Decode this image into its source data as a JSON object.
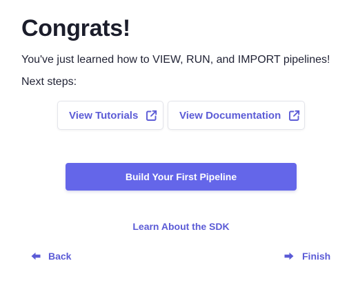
{
  "heading": "Congrats!",
  "message": "You've just learned how to VIEW, RUN, and IMPORT pipelines!",
  "next_steps_label": "Next steps:",
  "links": {
    "tutorials": {
      "label": "View Tutorials",
      "icon": "external-link-icon"
    },
    "documentation": {
      "label": "View Documentation",
      "icon": "external-link-icon"
    }
  },
  "primary_button": {
    "label": "Build Your First Pipeline"
  },
  "sdk_link": {
    "label": "Learn About the SDK"
  },
  "navigation": {
    "back": {
      "label": "Back",
      "icon": "arrow-left-icon"
    },
    "finish": {
      "label": "Finish",
      "icon": "arrow-right-icon"
    }
  },
  "colors": {
    "accent": "#6466e9",
    "link_text": "#5b5bd6",
    "heading_text": "#1b1d2b",
    "card_border": "#e3e4ea"
  }
}
